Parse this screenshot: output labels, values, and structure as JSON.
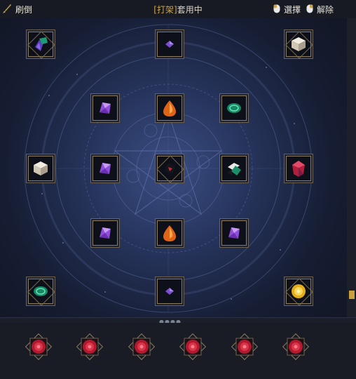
{
  "toolbar": {
    "refresh_label": "刷倒",
    "status_open": "[",
    "status_tag": "打架",
    "status_close": "]",
    "status_text": "套用中",
    "select_label": "選擇",
    "release_label": "解除"
  },
  "colors": {
    "accent_gold": "#caa54d",
    "board_blue": "#2f4270",
    "ruby": "#c41f35",
    "amethyst": "#9c4fe0",
    "amber": "#e06b18",
    "emerald": "#1f8f6a"
  },
  "sockets": [
    {
      "name": "socket-top-left-corner",
      "gem": "emerald-violet-cluster-icon"
    },
    {
      "name": "socket-top-center",
      "gem": "violet-small-icon"
    },
    {
      "name": "socket-top-right-corner",
      "gem": "white-cube-icon"
    },
    {
      "name": "socket-upper-left",
      "gem": "amethyst-icon"
    },
    {
      "name": "socket-upper-center",
      "gem": "amber-drop-icon"
    },
    {
      "name": "socket-upper-right",
      "gem": "emerald-oval-icon"
    },
    {
      "name": "socket-mid-far-left",
      "gem": "white-cube-icon"
    },
    {
      "name": "socket-mid-left",
      "gem": "amethyst-icon"
    },
    {
      "name": "socket-center",
      "gem": "black-red-core-icon"
    },
    {
      "name": "socket-mid-right",
      "gem": "emerald-white-icon"
    },
    {
      "name": "socket-mid-far-right",
      "gem": "ruby-crystal-icon"
    },
    {
      "name": "socket-lower-left",
      "gem": "amethyst-icon"
    },
    {
      "name": "socket-lower-center",
      "gem": "amber-drop-icon"
    },
    {
      "name": "socket-lower-right",
      "gem": "amethyst-icon"
    },
    {
      "name": "socket-bottom-left-corner",
      "gem": "emerald-oval-icon"
    },
    {
      "name": "socket-bottom-center",
      "gem": "violet-small-icon"
    },
    {
      "name": "socket-bottom-right-corner",
      "gem": "gold-citrine-icon"
    }
  ],
  "tray": [
    {
      "name": "tray-slot-1",
      "gem": "ruby-round-icon"
    },
    {
      "name": "tray-slot-2",
      "gem": "ruby-round-icon"
    },
    {
      "name": "tray-slot-3",
      "gem": "ruby-round-icon"
    },
    {
      "name": "tray-slot-4",
      "gem": "ruby-round-icon"
    },
    {
      "name": "tray-slot-5",
      "gem": "ruby-round-icon"
    },
    {
      "name": "tray-slot-6",
      "gem": "ruby-round-icon"
    }
  ]
}
